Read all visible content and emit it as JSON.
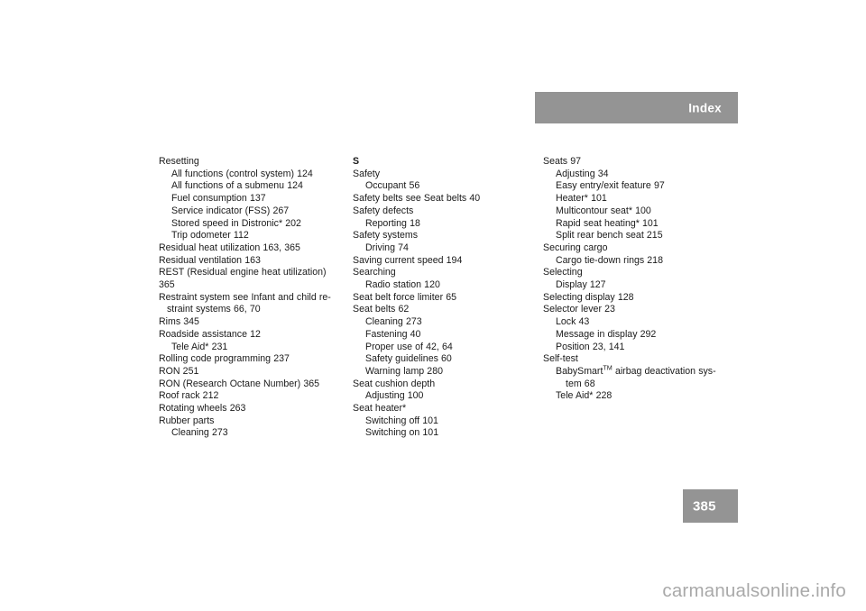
{
  "header": {
    "title": "Index",
    "banner_color": "#949494",
    "title_color": "#ffffff"
  },
  "footer": {
    "page_number": "385",
    "box_color": "#949494",
    "number_color": "#ffffff"
  },
  "watermark": {
    "text": "carmanualsonline.info",
    "color": "#a9a9a9"
  },
  "columns": [
    {
      "id": "column-1",
      "entries": [
        {
          "text": "Resetting",
          "level": 0
        },
        {
          "text": "All functions (control system) 124",
          "level": 1
        },
        {
          "text": "All functions of a submenu 124",
          "level": 1
        },
        {
          "text": "Fuel consumption 137",
          "level": 1
        },
        {
          "text": "Service indicator (FSS) 267",
          "level": 1
        },
        {
          "text": "Stored speed in Distronic* 202",
          "level": 1
        },
        {
          "text": "Trip odometer 112",
          "level": 1
        },
        {
          "text": "Residual heat utilization 163, 365",
          "level": 0
        },
        {
          "text": "Residual ventilation 163",
          "level": 0
        },
        {
          "text": "REST (Residual engine heat utilization) 365",
          "level": 0
        },
        {
          "text": "Restraint system see Infant and child re-",
          "level": 0
        },
        {
          "text": "straint systems 66, 70",
          "level": "cont-0"
        },
        {
          "text": "Rims 345",
          "level": 0
        },
        {
          "text": "Roadside assistance 12",
          "level": 0
        },
        {
          "text": "Tele Aid* 231",
          "level": 1
        },
        {
          "text": "Rolling code programming 237",
          "level": 0
        },
        {
          "text": "RON 251",
          "level": 0
        },
        {
          "text": "RON (Research Octane Number) 365",
          "level": 0
        },
        {
          "text": "Roof rack 212",
          "level": 0
        },
        {
          "text": "Rotating wheels 263",
          "level": 0
        },
        {
          "text": "Rubber parts",
          "level": 0
        },
        {
          "text": "Cleaning 273",
          "level": 1
        }
      ]
    },
    {
      "id": "column-2",
      "entries": [
        {
          "text": "S",
          "level": "section"
        },
        {
          "text": "Safety",
          "level": 0
        },
        {
          "text": "Occupant 56",
          "level": 1
        },
        {
          "text": "Safety belts see Seat belts 40",
          "level": 0
        },
        {
          "text": "Safety defects",
          "level": 0
        },
        {
          "text": "Reporting 18",
          "level": 1
        },
        {
          "text": "Safety systems",
          "level": 0
        },
        {
          "text": "Driving 74",
          "level": 1
        },
        {
          "text": "Saving current speed 194",
          "level": 0
        },
        {
          "text": "Searching",
          "level": 0
        },
        {
          "text": "Radio station 120",
          "level": 1
        },
        {
          "text": "Seat belt force limiter 65",
          "level": 0
        },
        {
          "text": "Seat belts 62",
          "level": 0
        },
        {
          "text": "Cleaning 273",
          "level": 1
        },
        {
          "text": "Fastening 40",
          "level": 1
        },
        {
          "text": "Proper use of 42, 64",
          "level": 1
        },
        {
          "text": "Safety guidelines 60",
          "level": 1
        },
        {
          "text": "Warning lamp 280",
          "level": 1
        },
        {
          "text": "Seat cushion depth",
          "level": 0
        },
        {
          "text": "Adjusting 100",
          "level": 1
        },
        {
          "text": "Seat heater*",
          "level": 0
        },
        {
          "text": "Switching off 101",
          "level": 1
        },
        {
          "text": "Switching on 101",
          "level": 1
        }
      ]
    },
    {
      "id": "column-3",
      "entries": [
        {
          "text": "Seats 97",
          "level": 0
        },
        {
          "text": "Adjusting 34",
          "level": 1
        },
        {
          "text": "Easy entry/exit feature 97",
          "level": 1
        },
        {
          "text": "Heater* 101",
          "level": 1
        },
        {
          "text": "Multicontour seat* 100",
          "level": 1
        },
        {
          "text": "Rapid seat heating* 101",
          "level": 1
        },
        {
          "text": "Split rear bench seat 215",
          "level": 1
        },
        {
          "text": "Securing cargo",
          "level": 0
        },
        {
          "text": "Cargo tie-down rings 218",
          "level": 1
        },
        {
          "text": "Selecting",
          "level": 0
        },
        {
          "text": "Display 127",
          "level": 1
        },
        {
          "text": "Selecting display 128",
          "level": 0
        },
        {
          "text": "Selector lever 23",
          "level": 0
        },
        {
          "text": "Lock 43",
          "level": 1
        },
        {
          "text": "Message in display 292",
          "level": 1
        },
        {
          "text": "Position 23, 141",
          "level": 1
        },
        {
          "text": "Self-test",
          "level": 0
        },
        {
          "text": "BabySmart",
          "level": 1,
          "sup": "TM",
          "after_sup": " airbag deactivation sys-"
        },
        {
          "text": "tem 68",
          "level": "cont-1"
        },
        {
          "text": "Tele Aid* 228",
          "level": 1
        }
      ]
    }
  ]
}
